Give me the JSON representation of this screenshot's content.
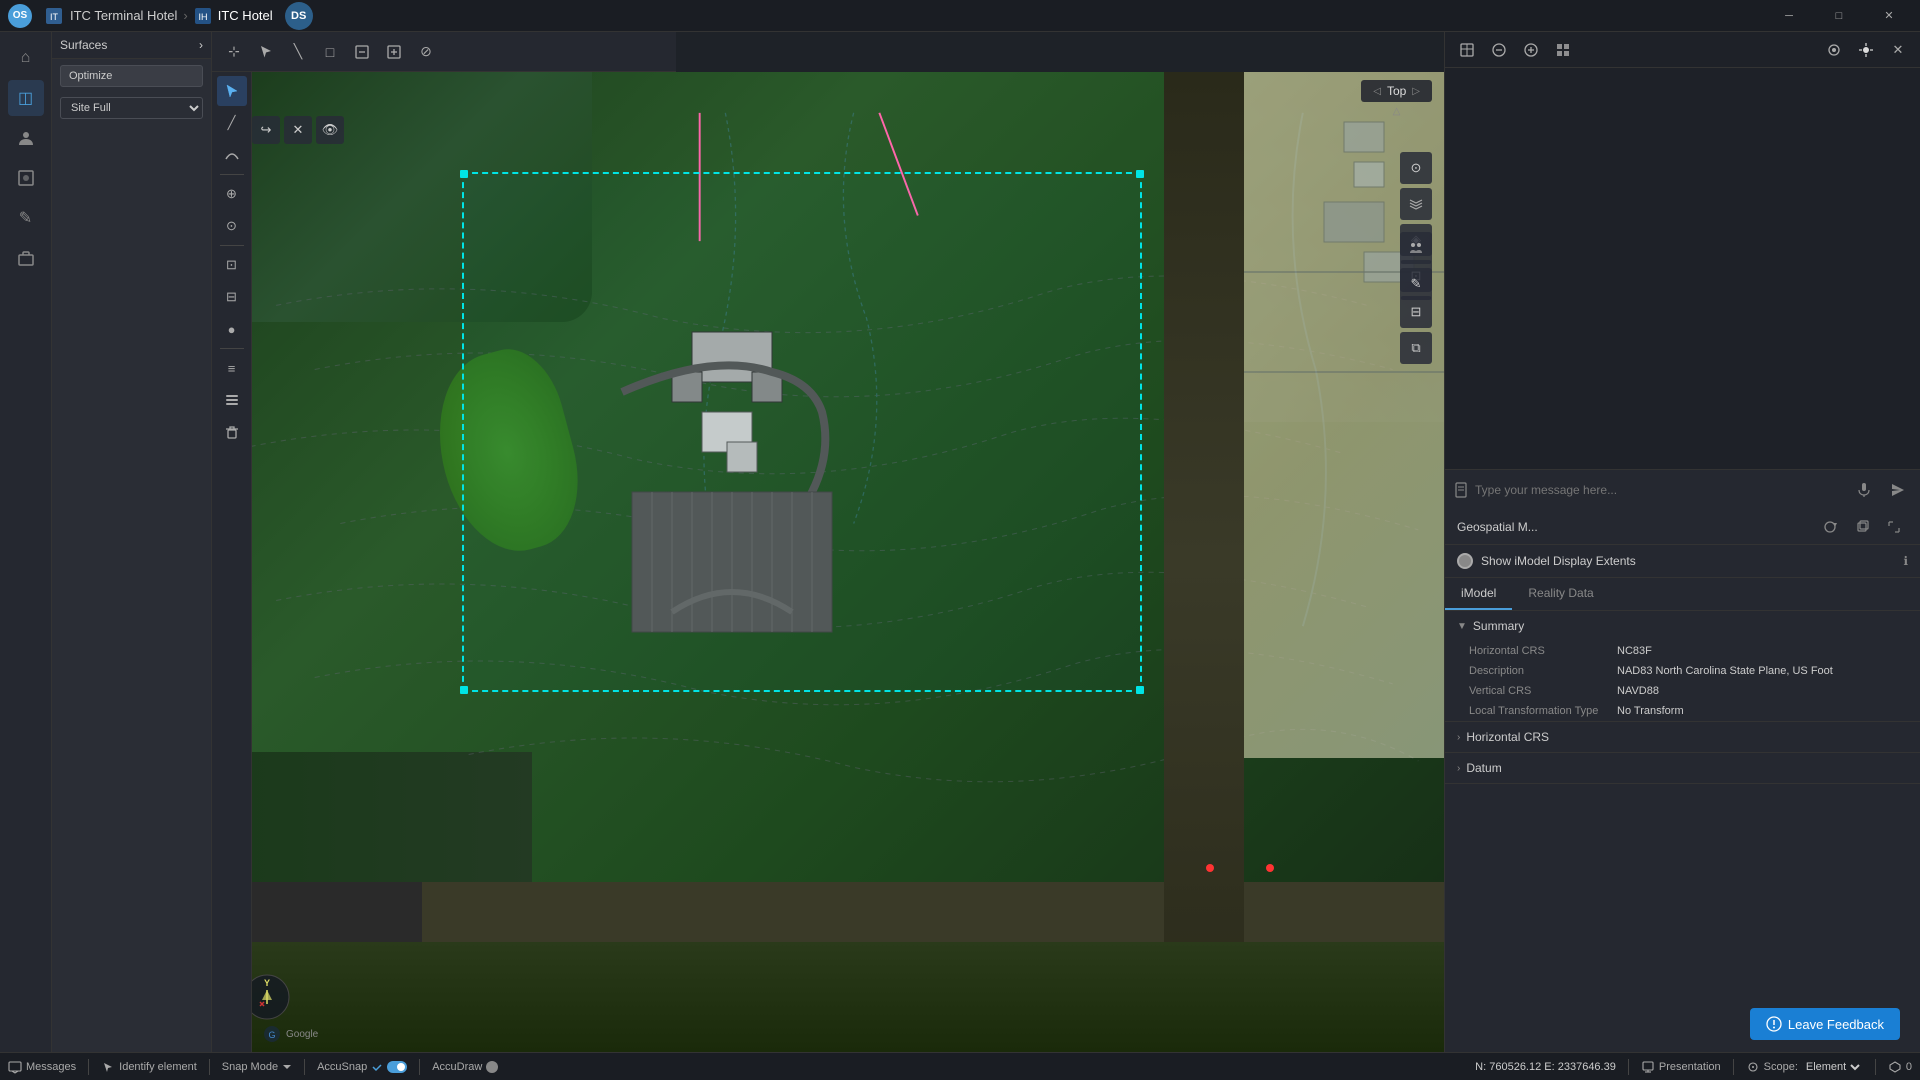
{
  "titlebar": {
    "app_icon": "OS",
    "breadcrumbs": [
      {
        "label": "ITC Terminal Hotel",
        "active": false
      },
      {
        "label": "ITC Hotel",
        "active": true
      }
    ],
    "win_buttons": [
      "─",
      "□",
      "✕"
    ],
    "avatar": "DS"
  },
  "left_sidebar": {
    "icons": [
      {
        "name": "home-icon",
        "symbol": "⌂",
        "active": false
      },
      {
        "name": "layers-icon",
        "symbol": "◫",
        "active": false
      },
      {
        "name": "person-icon",
        "symbol": "👤",
        "active": false
      },
      {
        "name": "data-icon",
        "symbol": "◈",
        "active": false
      },
      {
        "name": "edit-icon",
        "symbol": "✎",
        "active": false
      },
      {
        "name": "briefcase-icon",
        "symbol": "💼",
        "active": false
      }
    ]
  },
  "panel": {
    "header": "Surfaces",
    "optimize_btn": "Optimize",
    "site_select": "Site Full"
  },
  "toolbar": {
    "tools": [
      "⊹",
      "◇",
      "╲",
      "□",
      "⊟",
      "⊞",
      "⊘"
    ]
  },
  "view_toolbar": {
    "buttons": [
      "↩",
      "↪",
      "✕",
      "👁"
    ],
    "view_mode": "Top",
    "nav_icons": [
      "⊙",
      "⊙",
      "◈",
      "⊡",
      "⊟",
      "⧉"
    ]
  },
  "right_panel": {
    "toolbar_icons": [
      "⊠",
      "⊟",
      "⊕",
      "⊞"
    ],
    "settings_row": {
      "show_imodel_label": "Show iModel Display Extents",
      "toggle": true,
      "info_icon": "ℹ"
    },
    "tabs": [
      {
        "label": "iModel",
        "active": true
      },
      {
        "label": "Reality Data",
        "active": false
      }
    ],
    "geo_section": "Geospatial M...",
    "chat_placeholder": "Type your message here...",
    "summary": {
      "title": "Summary",
      "expanded": true,
      "rows": [
        {
          "label": "Horizontal CRS",
          "value": "NC83F"
        },
        {
          "label": "Description",
          "value": "NAD83 North Carolina State Plane, US Foot"
        },
        {
          "label": "Vertical CRS",
          "value": "NAVD88"
        },
        {
          "label": "Local Transformation Type",
          "value": "No Transform"
        }
      ]
    },
    "horizontal_crs": {
      "title": "Horizontal CRS",
      "expanded": false
    },
    "datum": {
      "title": "Datum",
      "expanded": false
    }
  },
  "statusbar": {
    "messages_label": "Messages",
    "identify_label": "Identify element",
    "snap_mode_label": "Snap Mode",
    "accu_snap_label": "AccuSnap",
    "accu_draw_label": "AccuDraw",
    "coordinates": "N: 760526.12 E: 2337646.39",
    "presentation_label": "Presentation",
    "scope_label": "Scope:",
    "scope_value": "Element",
    "count": "0"
  },
  "feedback_btn": "Leave Feedback",
  "draw_tools": {
    "icons": [
      "⊕",
      "╱",
      "╱",
      "⊕",
      "⊙",
      "⊡",
      "⊟",
      "●",
      "⊙",
      "≡",
      "⊟",
      "⊟"
    ]
  }
}
